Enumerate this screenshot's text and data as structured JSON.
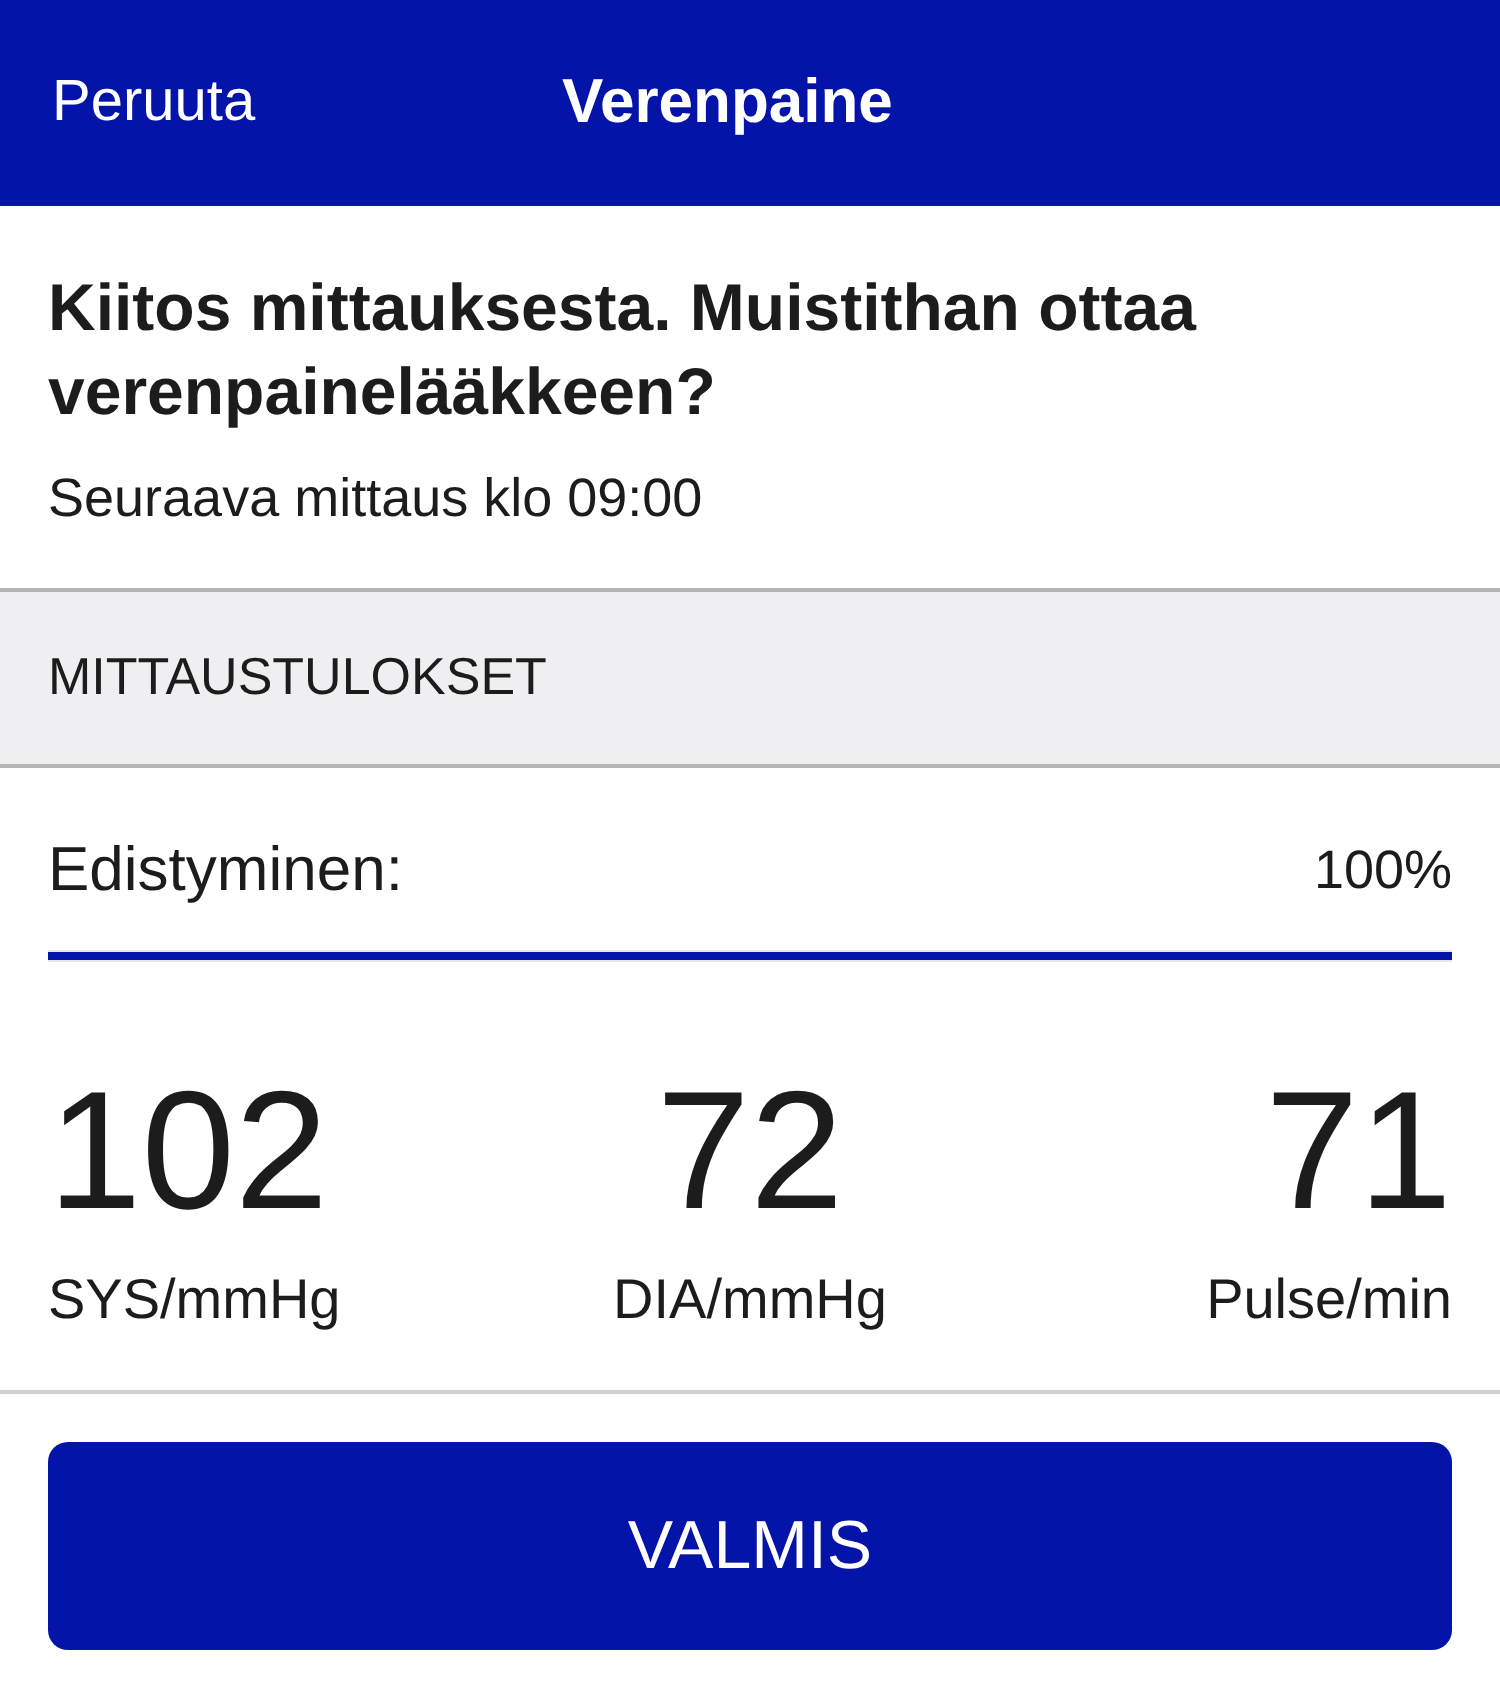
{
  "nav_bar": {
    "cancel": "Peruuta",
    "title": "Verenpaine"
  },
  "message": {
    "heading": "Kiitos mittauksesta. Muistithan ottaa verenpainelääkkeen?",
    "next": "Seuraava mittaus klo 09:00"
  },
  "section": {
    "title": "MITTAUSTULOKSET"
  },
  "progress": {
    "label": "Edistyminen:",
    "reading": "100%",
    "level": 1
  },
  "readings": [
    {
      "value": "102",
      "unit": "SYS/mmHg"
    },
    {
      "value": "72",
      "unit": "DIA/mmHg"
    },
    {
      "value": "71",
      "unit": "Pulse/min"
    }
  ],
  "button": {
    "label": "VALMIS"
  }
}
